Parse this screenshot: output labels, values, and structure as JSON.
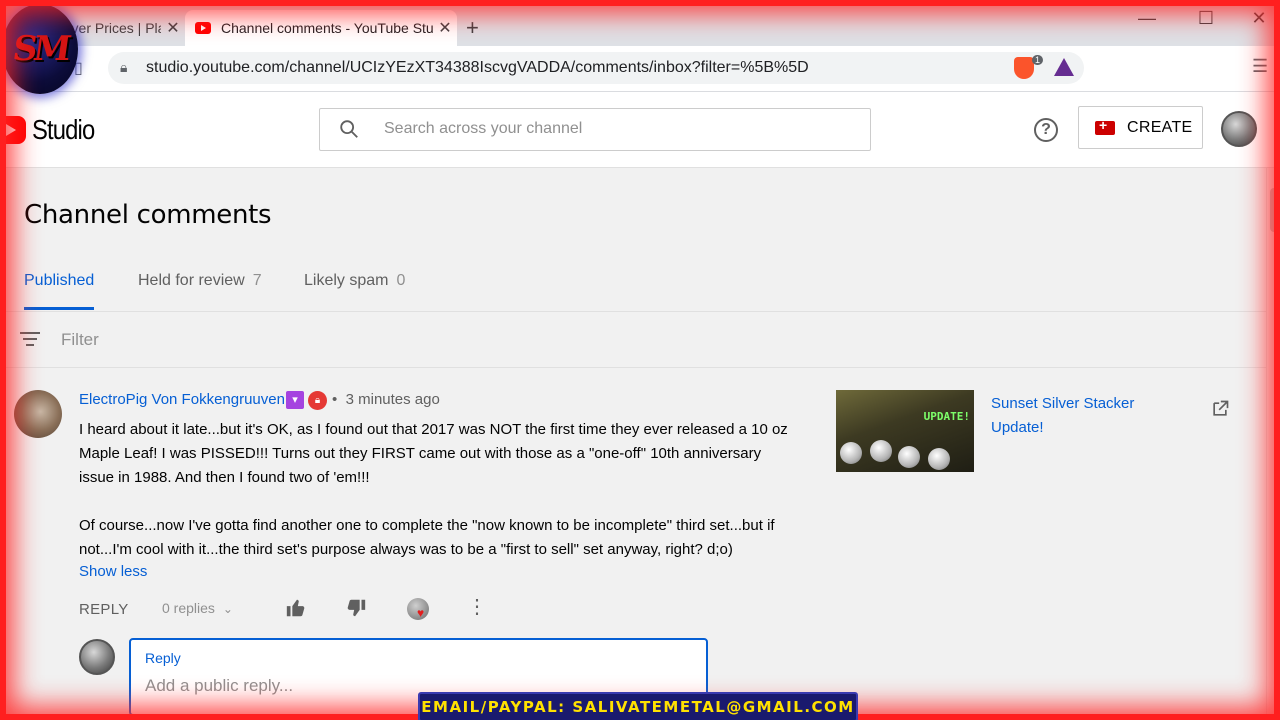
{
  "browser": {
    "tabs": [
      {
        "title": "Silver Prices | Pla",
        "active": false
      },
      {
        "title": "Channel comments - YouTube Stu",
        "active": true
      }
    ],
    "url": "studio.youtube.com/channel/UCIzYEzXT34388IscvgVADDA/comments/inbox?filter=%5B%5D",
    "brave_badge": "1"
  },
  "overlay": {
    "logo_text": "SM",
    "email_banner": "EMAIL/PAYPAL: SALIVATEMETAL@GMAIL.COM"
  },
  "header": {
    "brand": "Studio",
    "search_placeholder": "Search across your channel",
    "create_label": "CREATE"
  },
  "page": {
    "title": "Channel comments",
    "tabs": [
      {
        "label": "Published",
        "count": ""
      },
      {
        "label": "Held for review",
        "count": "7"
      },
      {
        "label": "Likely spam",
        "count": "0"
      }
    ],
    "filter_label": "Filter"
  },
  "comment": {
    "author": "ElectroPig Von Fokkengruuven",
    "separator": "•",
    "time": "3 minutes ago",
    "paragraphs": [
      "I heard about it late...but it's OK, as I found out that 2017 was NOT the first time they ever released a 10 oz Maple Leaf!  I was PISSED!!!  Turns out they FIRST came out with those as a \"one-off\" 10th anniversary issue in 1988.  And then I found two of 'em!!!",
      "Of course...now I've gotta find another one to complete the \"now known to be incomplete\" third set...but if not...I'm cool with it...the third set's purpose always was to be a \"first to sell\" set anyway, right?  d;o)"
    ],
    "show_less": "Show less",
    "reply_label": "REPLY",
    "replies_count": "0 replies",
    "reply_box_label": "Reply",
    "reply_placeholder": "Add a public reply..."
  },
  "video": {
    "title": "Sunset Silver Stacker Update!",
    "thumb_text": "UPDATE!"
  },
  "colors": {
    "accent_blue": "#065fd4",
    "youtube_red": "#ff0000",
    "frame_red": "#ff1f1f",
    "banner_yellow": "#ffe100"
  }
}
